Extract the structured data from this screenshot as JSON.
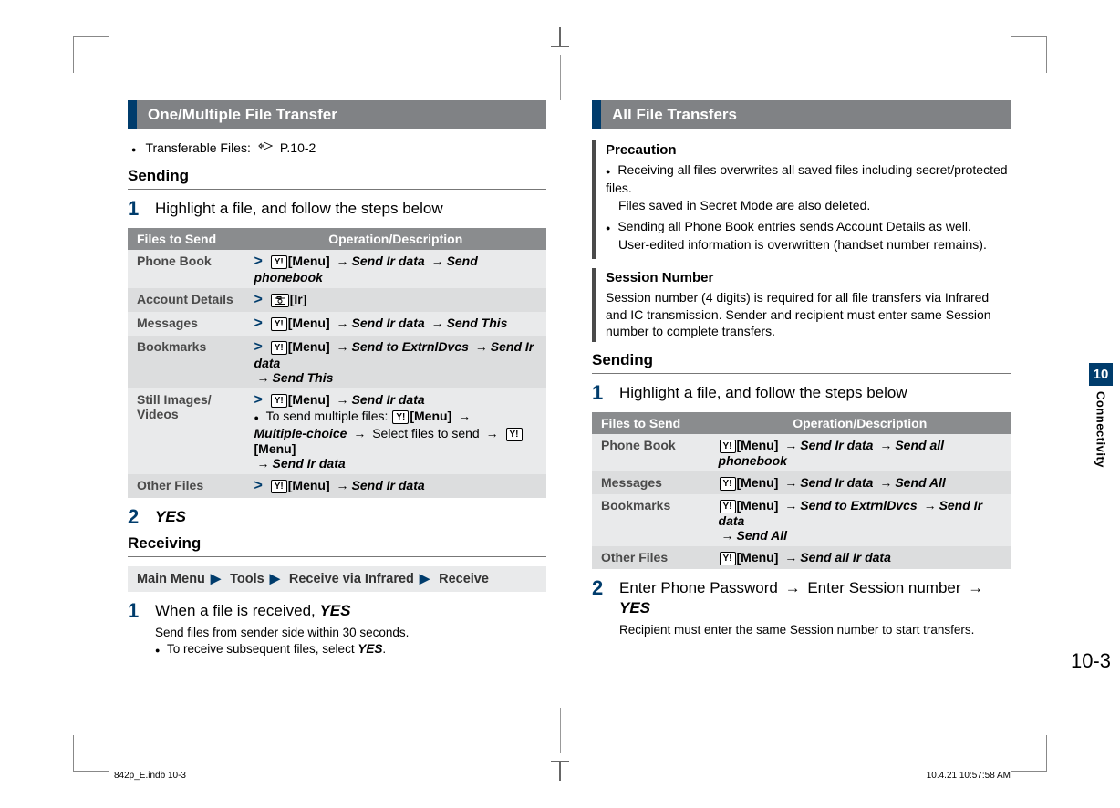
{
  "left": {
    "section_title": "One/Multiple File Transfer",
    "transferable_label": "Transferable Files:",
    "transferable_ref": "P.10-2",
    "sending_heading": "Sending",
    "step1_text": "Highlight a file, and follow the steps below",
    "table": {
      "h1": "Files to Send",
      "h2": "Operation/Description",
      "rows": [
        {
          "label": "Phone Book",
          "menu": "[Menu]",
          "chain": [
            "Send Ir data",
            "Send phonebook"
          ]
        },
        {
          "label": "Account Details",
          "ir_label": "[Ir]"
        },
        {
          "label": "Messages",
          "menu": "[Menu]",
          "chain": [
            "Send Ir data",
            "Send This"
          ]
        },
        {
          "label": "Bookmarks",
          "menu": "[Menu]",
          "chain": [
            "Send to ExtrnlDvcs",
            "Send Ir data",
            "Send This"
          ]
        },
        {
          "label": "Still Images/ Videos",
          "menu": "[Menu]",
          "chain": [
            "Send Ir data"
          ],
          "note_prefix": "To send multiple files:",
          "note_menu": "[Menu]",
          "note_chain1": "Multiple-choice",
          "note_select": "Select files to send",
          "note_menu2": "[Menu]",
          "note_chain2": "Send Ir data"
        },
        {
          "label": "Other Files",
          "menu": "[Menu]",
          "chain": [
            "Send Ir data"
          ]
        }
      ]
    },
    "step2_text": "YES",
    "receiving_heading": "Receiving",
    "menu_path": [
      "Main Menu",
      "Tools",
      "Receive via Infrared",
      "Receive"
    ],
    "recv_step1_prefix": "When a file is received, ",
    "recv_step1_yes": "YES",
    "recv_note1": "Send files from sender side within 30 seconds.",
    "recv_note2_prefix": "To receive subsequent files, select ",
    "recv_note2_yes": "YES",
    "recv_note2_suffix": "."
  },
  "right": {
    "section_title": "All File Transfers",
    "precaution_title": "Precaution",
    "precaution_b1a": "Receiving all files overwrites all saved files including secret/protected files.",
    "precaution_b1b": "Files saved in Secret Mode are also deleted.",
    "precaution_b2a": "Sending all Phone Book entries sends Account Details as well.",
    "precaution_b2b": "User-edited information is overwritten (handset number remains).",
    "session_title": "Session Number",
    "session_body": "Session number (4 digits) is required for all file transfers via Infrared and IC transmission. Sender and recipient must enter same Session number to complete transfers.",
    "sending_heading": "Sending",
    "step1_text": "Highlight a file, and follow the steps below",
    "table": {
      "h1": "Files to Send",
      "h2": "Operation/Description",
      "rows": [
        {
          "label": "Phone Book",
          "menu": "[Menu]",
          "chain": [
            "Send Ir data",
            "Send all phonebook"
          ]
        },
        {
          "label": "Messages",
          "menu": "[Menu]",
          "chain": [
            "Send Ir data",
            "Send All"
          ]
        },
        {
          "label": "Bookmarks",
          "menu": "[Menu]",
          "chain": [
            "Send to ExtrnlDvcs",
            "Send Ir data",
            "Send All"
          ]
        },
        {
          "label": "Other Files",
          "menu": "[Menu]",
          "chain": [
            "Send all Ir data"
          ]
        }
      ]
    },
    "step2_text_a": "Enter Phone Password ",
    "step2_text_b": " Enter Session number ",
    "step2_yes": "YES",
    "step2_note": "Recipient must enter the same Session number to start transfers."
  },
  "side": {
    "chapter_num": "10",
    "chapter_name": "Connectivity"
  },
  "page_number": "10-3",
  "footer_left": "842p_E.indb   10-3",
  "footer_right": "10.4.21   10:57:58 AM"
}
